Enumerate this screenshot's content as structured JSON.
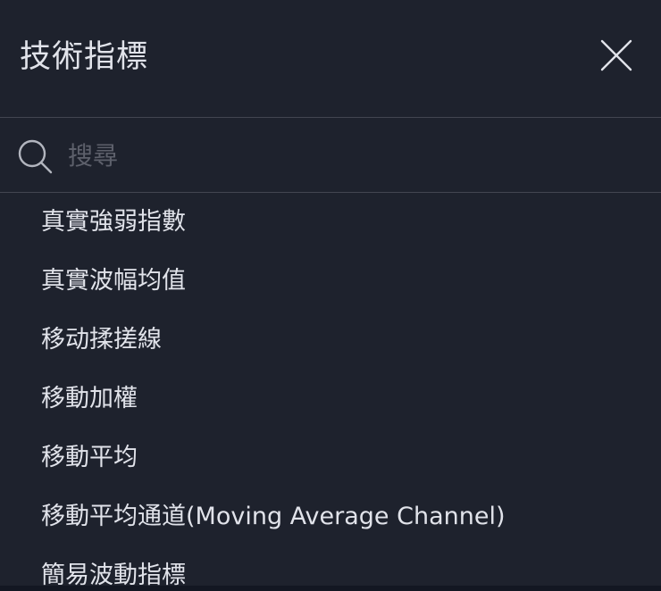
{
  "dialog": {
    "title": "技術指標",
    "close_icon": "close-icon"
  },
  "search": {
    "placeholder": "搜尋",
    "value": "",
    "icon": "search-icon"
  },
  "indicators": [
    {
      "label": "真實強弱指數"
    },
    {
      "label": "真實波幅均值"
    },
    {
      "label": "移动揉搓線"
    },
    {
      "label": "移動加權"
    },
    {
      "label": "移動平均"
    },
    {
      "label": "移動平均通道(Moving Average Channel)"
    },
    {
      "label": "簡易波動指標"
    }
  ],
  "background_partial_text": "...",
  "colors": {
    "background": "#1e222d",
    "divider": "#434651",
    "text": "#e1e3ea",
    "placeholder": "#5d606b"
  }
}
